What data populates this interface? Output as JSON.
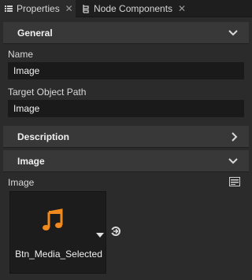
{
  "tabs": [
    {
      "label": "Properties",
      "icon": "list-icon",
      "active": true
    },
    {
      "label": "Node Components",
      "icon": "components-icon",
      "active": false
    }
  ],
  "sections": {
    "general": {
      "title": "General",
      "expanded": true
    },
    "description": {
      "title": "Description",
      "expanded": false
    },
    "image": {
      "title": "Image",
      "expanded": true
    }
  },
  "fields": {
    "name": {
      "label": "Name",
      "value": "Image"
    },
    "target_object_path": {
      "label": "Target Object Path",
      "value": "Image"
    }
  },
  "image_property": {
    "label": "Image",
    "asset_name": "Btn_Media_Selected",
    "asset_icon": "music-note-icon",
    "accent_color": "#f08a1e"
  }
}
